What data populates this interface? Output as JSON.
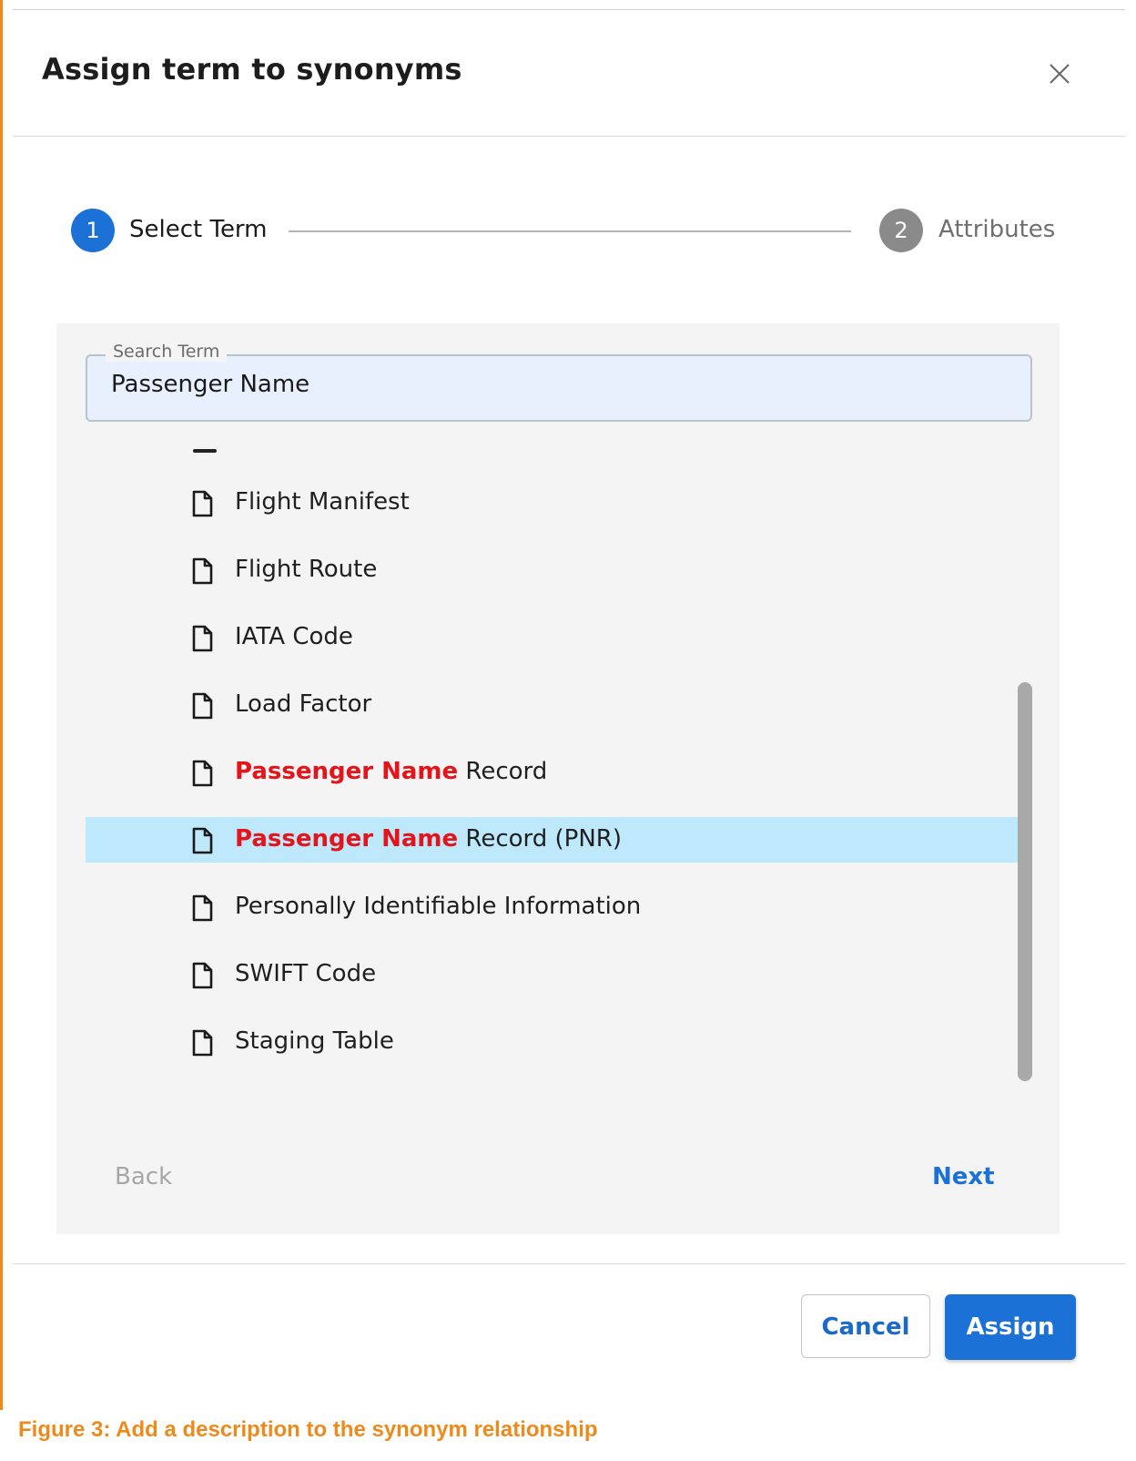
{
  "dialog": {
    "title": "Assign term to synonyms",
    "close_icon": "close-icon"
  },
  "stepper": {
    "steps": [
      {
        "number": "1",
        "label": "Select Term",
        "state": "active"
      },
      {
        "number": "2",
        "label": "Attributes",
        "state": "inactive"
      }
    ]
  },
  "search": {
    "label": "Search Term",
    "value": "Passenger Name"
  },
  "results": {
    "items": [
      {
        "highlight": "",
        "rest": "Flight Manifest",
        "selected": false
      },
      {
        "highlight": "",
        "rest": "Flight Route",
        "selected": false
      },
      {
        "highlight": "",
        "rest": "IATA Code",
        "selected": false
      },
      {
        "highlight": "",
        "rest": "Load Factor",
        "selected": false
      },
      {
        "highlight": "Passenger Name",
        "rest": " Record",
        "selected": false
      },
      {
        "highlight": "Passenger Name",
        "rest": " Record (PNR)",
        "selected": true
      },
      {
        "highlight": "",
        "rest": "Personally Identifiable Information",
        "selected": false
      },
      {
        "highlight": "",
        "rest": "SWIFT Code",
        "selected": false
      },
      {
        "highlight": "",
        "rest": "Staging Table",
        "selected": false
      }
    ],
    "item_icon": "document-icon"
  },
  "nav": {
    "back_label": "Back",
    "next_label": "Next"
  },
  "footer": {
    "cancel_label": "Cancel",
    "assign_label": "Assign"
  },
  "caption": "Figure 3: Add a description to the synonym relationship",
  "colors": {
    "accent": "#1b71d6",
    "highlight_text": "#e5131a",
    "selected_row": "#bee8fb",
    "caption": "#ee8a1c"
  }
}
